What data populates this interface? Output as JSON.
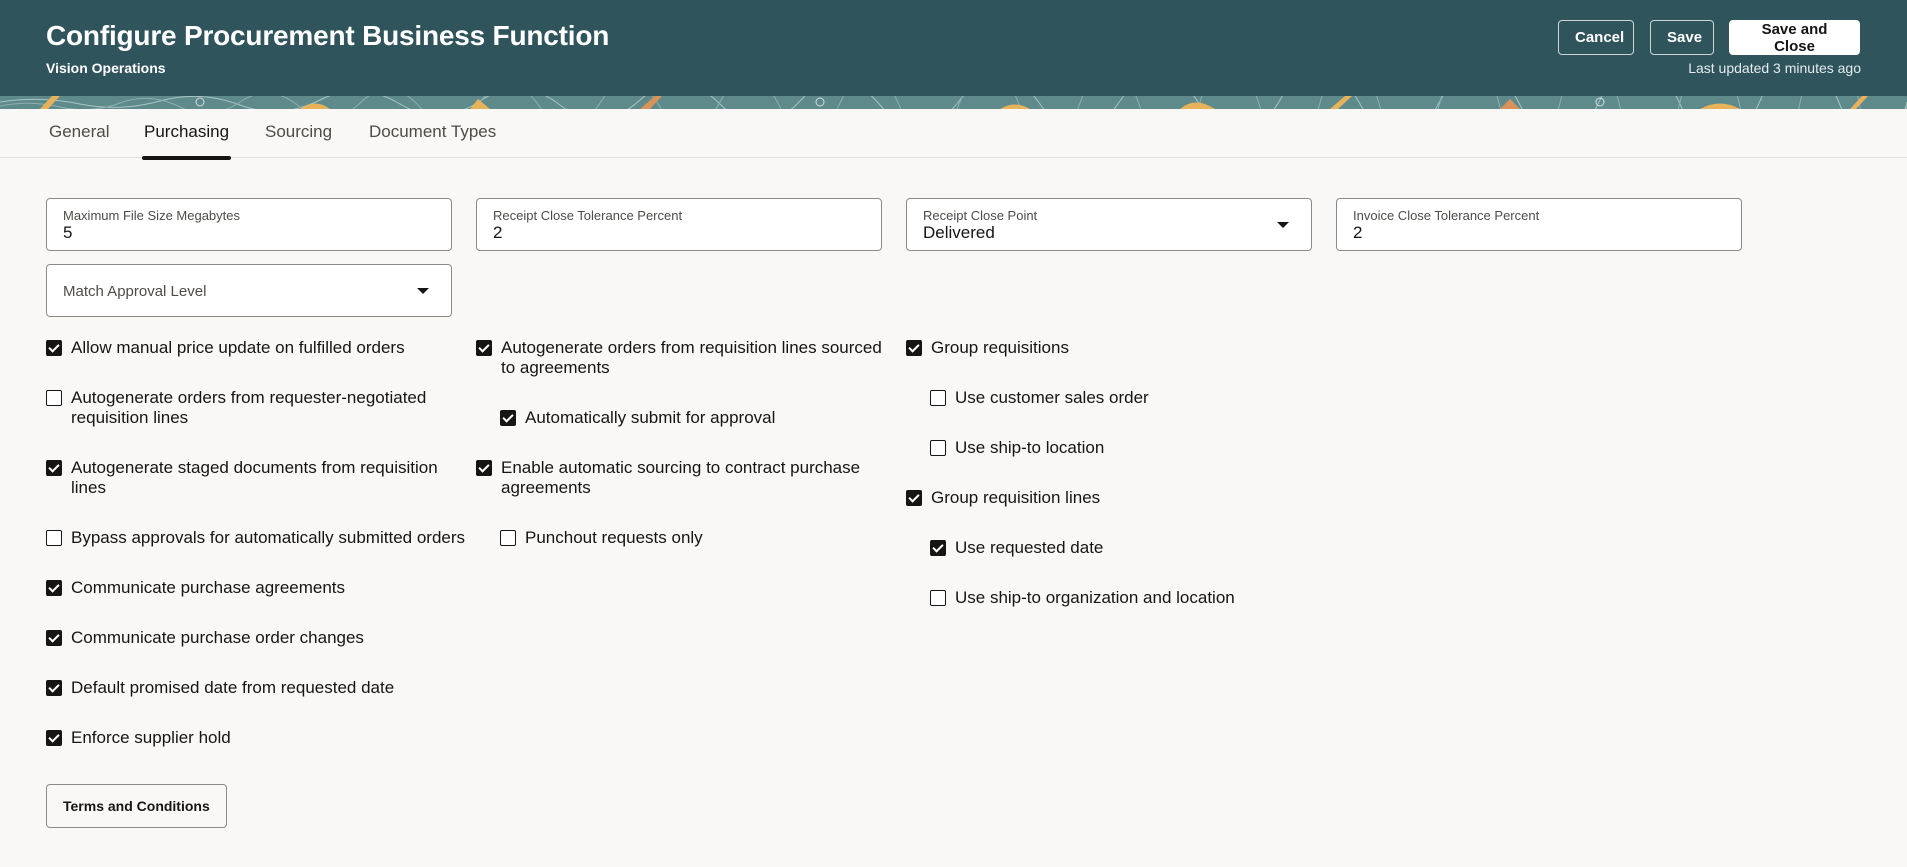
{
  "header": {
    "title": "Configure Procurement Business Function",
    "subtitle": "Vision Operations",
    "cancel_label": "Cancel",
    "save_label": "Save",
    "save_close_label": "Save and Close",
    "last_updated": "Last updated 3 minutes ago",
    "colors": {
      "background": "#30545c",
      "band_accent": "#e8b25a"
    }
  },
  "tabs": [
    {
      "label": "General",
      "active": false
    },
    {
      "label": "Purchasing",
      "active": true
    },
    {
      "label": "Sourcing",
      "active": false
    },
    {
      "label": "Document Types",
      "active": false
    }
  ],
  "fields": {
    "max_file_size": {
      "label": "Maximum File Size Megabytes",
      "value": "5"
    },
    "receipt_close_tolerance": {
      "label": "Receipt Close Tolerance Percent",
      "value": "2"
    },
    "receipt_close_point": {
      "label": "Receipt Close Point",
      "value": "Delivered"
    },
    "invoice_close_tolerance": {
      "label": "Invoice Close Tolerance Percent",
      "value": "2"
    },
    "match_approval_level": {
      "placeholder": "Match Approval Level",
      "value": ""
    }
  },
  "checkboxes": {
    "col1": [
      {
        "label": "Allow manual price update on fulfilled orders",
        "checked": true
      },
      {
        "label": "Autogenerate orders from requester-negotiated requisition lines",
        "checked": false
      },
      {
        "label": "Autogenerate staged documents from requisition lines",
        "checked": true
      },
      {
        "label": "Bypass approvals for automatically submitted orders",
        "checked": false
      },
      {
        "label": "Communicate purchase agreements",
        "checked": true
      },
      {
        "label": "Communicate purchase order changes",
        "checked": true
      },
      {
        "label": "Default promised date from requested date",
        "checked": true
      },
      {
        "label": "Enforce supplier hold",
        "checked": true
      }
    ],
    "col2": [
      {
        "label": "Autogenerate orders from requisition lines sourced to agreements",
        "checked": true
      },
      {
        "label": "Automatically submit for approval",
        "checked": true
      },
      {
        "label": "Enable automatic sourcing to contract purchase agreements",
        "checked": true
      },
      {
        "label": "Punchout requests only",
        "checked": false
      }
    ],
    "col3": [
      {
        "label": "Group requisitions",
        "checked": true
      },
      {
        "label": "Use customer sales order",
        "checked": false
      },
      {
        "label": "Use ship-to location",
        "checked": false
      },
      {
        "label": "Group requisition lines",
        "checked": true
      },
      {
        "label": "Use requested date",
        "checked": true
      },
      {
        "label": "Use ship-to organization and location",
        "checked": false
      }
    ]
  },
  "terms_button_label": "Terms and Conditions"
}
